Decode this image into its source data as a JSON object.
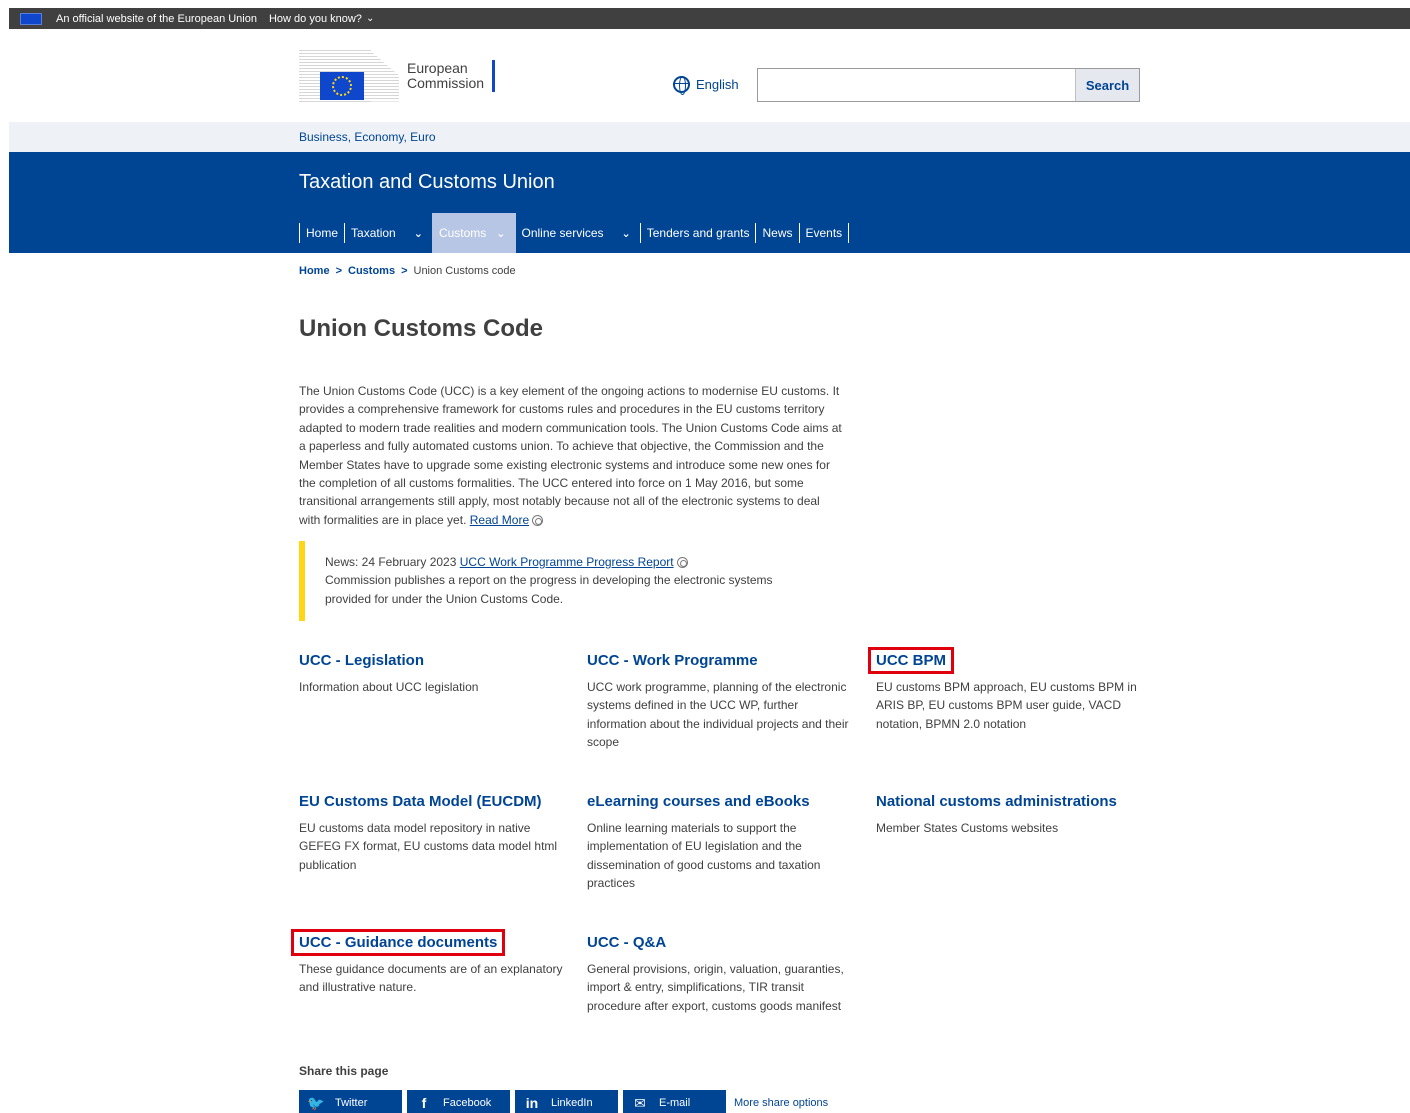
{
  "topbar": {
    "official": "An official website of the European Union",
    "how_know": "How do you know?"
  },
  "header": {
    "logo_line1": "European",
    "logo_line2": "Commission",
    "language": "English",
    "search_placeholder": "",
    "search_button": "Search"
  },
  "site_link": "Business, Economy, Euro",
  "banner": {
    "title": "Taxation and Customs Union",
    "nav": [
      {
        "label": "Home"
      },
      {
        "label": "Taxation"
      },
      {
        "label": "Customs"
      },
      {
        "label": "Online services"
      },
      {
        "label": "Tenders and grants"
      },
      {
        "label": "News"
      },
      {
        "label": "Events"
      }
    ]
  },
  "breadcrumb": {
    "items": [
      "Home",
      "Customs"
    ],
    "current": "Union Customs code"
  },
  "page_title": "Union Customs Code",
  "intro": {
    "text": "The Union Customs Code (UCC) is a key element of the ongoing actions to modernise EU customs. It provides a comprehensive framework for customs rules and procedures in the EU customs territory adapted to modern trade realities and modern communication tools. The Union Customs Code aims at a paperless and fully automated customs union. To achieve that objective, the Commission and the Member States have to upgrade some existing electronic systems and introduce some new ones for the completion of all customs formalities. The UCC entered into force on 1 May 2016, but some transitional arrangements still apply, most notably because not all of the electronic systems to deal with formalities are in place yet.",
    "read_more": "Read More"
  },
  "news": {
    "prefix": "News: 24 February 2023",
    "link": "UCC Work Programme Progress Report",
    "body": "Commission publishes a report on the progress in developing the electronic systems provided for under the Union Customs Code."
  },
  "cards": [
    {
      "title": "UCC - Legislation",
      "desc": "Information about UCC legislation"
    },
    {
      "title": "UCC - Work Programme",
      "desc": "UCC work programme, planning of the electronic systems defined in the UCC WP, further information about the individual projects and their scope"
    },
    {
      "title": "UCC BPM",
      "desc": "EU customs BPM approach, EU customs BPM in ARIS BP, EU customs BPM user guide, VACD notation, BPMN 2.0 notation"
    },
    {
      "title": "EU Customs Data Model (EUCDM)",
      "desc": "EU customs data model repository in native GEFEG FX format, EU customs data model html publication"
    },
    {
      "title": "eLearning courses and eBooks",
      "desc": "Online learning materials to support the implementation of EU legislation and the dissemination of good customs and taxation practices"
    },
    {
      "title": "National customs administrations",
      "desc": "Member States Customs websites"
    },
    {
      "title": "UCC - Guidance documents",
      "desc": "These guidance documents are of an explanatory and illustrative nature."
    },
    {
      "title": "UCC - Q&A",
      "desc": "General provisions, origin, valuation, guaranties, import & entry, simplifications, TIR transit procedure after export, customs goods manifest"
    }
  ],
  "share": {
    "label": "Share this page",
    "buttons": [
      "Twitter",
      "Facebook",
      "LinkedIn",
      "E-mail"
    ],
    "more": "More share options"
  },
  "colors": {
    "primary_blue": "#004494",
    "active_nav": "#b7c6e4",
    "news_bar": "#ffd617",
    "highlight_red": "#e0000d"
  }
}
